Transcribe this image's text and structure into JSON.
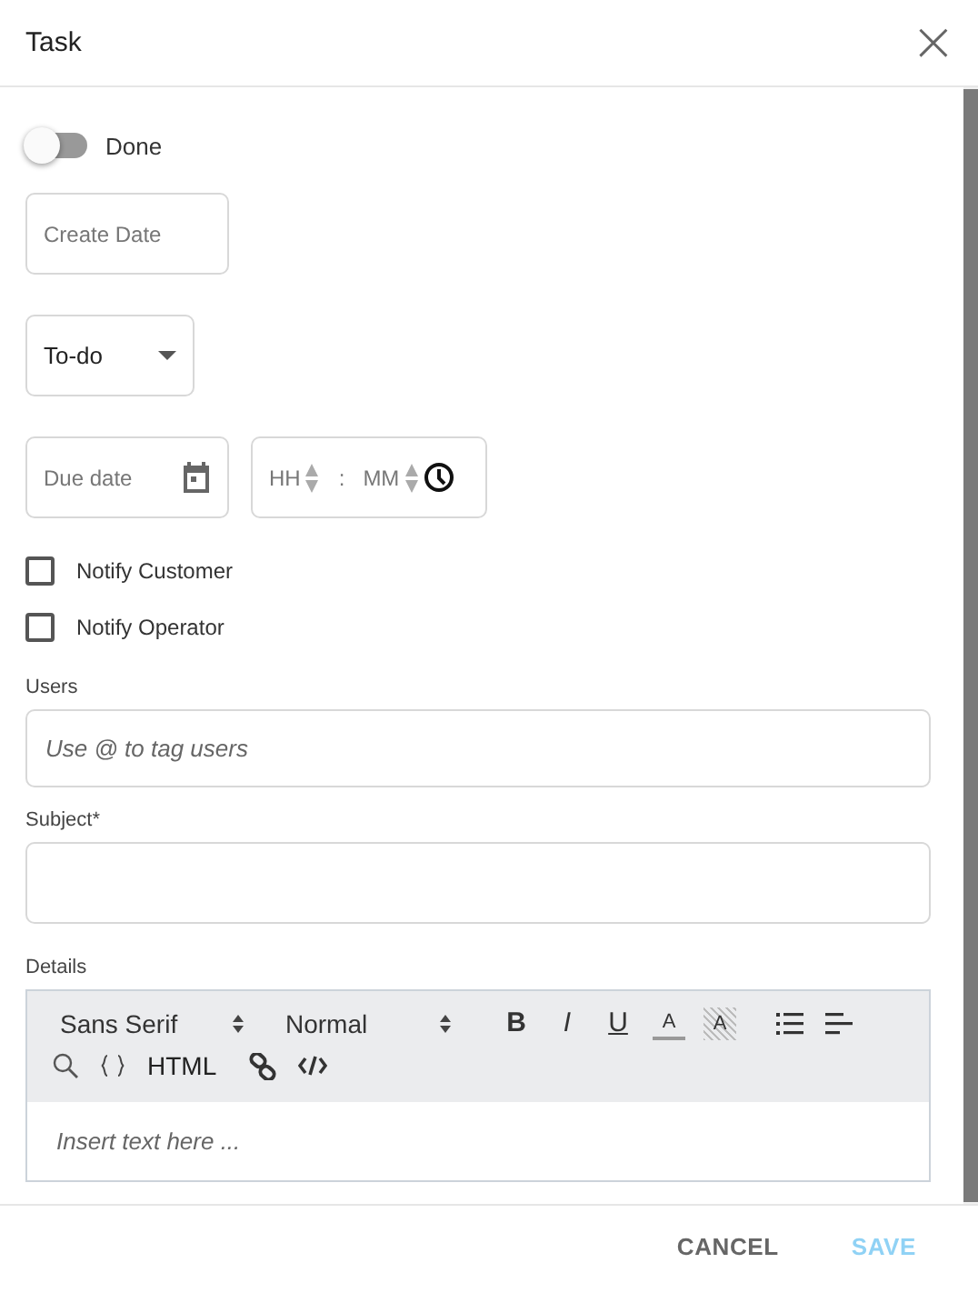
{
  "dialog": {
    "title": "Task",
    "close": "×"
  },
  "done_toggle": {
    "label": "Done",
    "on": false
  },
  "create_date": {
    "placeholder": "Create Date"
  },
  "status_select": {
    "value": "To-do"
  },
  "due_date": {
    "placeholder": "Due date"
  },
  "time": {
    "hours_placeholder": "HH",
    "separator": ":",
    "minutes_placeholder": "MM"
  },
  "checkboxes": [
    {
      "label": "Notify Customer",
      "checked": false
    },
    {
      "label": "Notify Operator",
      "checked": false
    }
  ],
  "users": {
    "label": "Users",
    "placeholder": "Use @ to tag users"
  },
  "subject": {
    "label": "Subject*"
  },
  "details": {
    "label": "Details",
    "font": "Sans Serif",
    "size": "Normal",
    "format_buttons": [
      {
        "kind": "bold",
        "label": "B"
      },
      {
        "kind": "italic",
        "label": "I"
      },
      {
        "kind": "underline",
        "label": "U"
      },
      {
        "kind": "color",
        "label": "A"
      },
      {
        "kind": "background",
        "label": "A"
      }
    ],
    "html_button": "HTML",
    "placeholder": "Insert text here ..."
  },
  "footer": {
    "buttons": [
      {
        "label": "CANCEL",
        "disabled": false
      },
      {
        "label": "SAVE",
        "disabled": true
      }
    ]
  }
}
